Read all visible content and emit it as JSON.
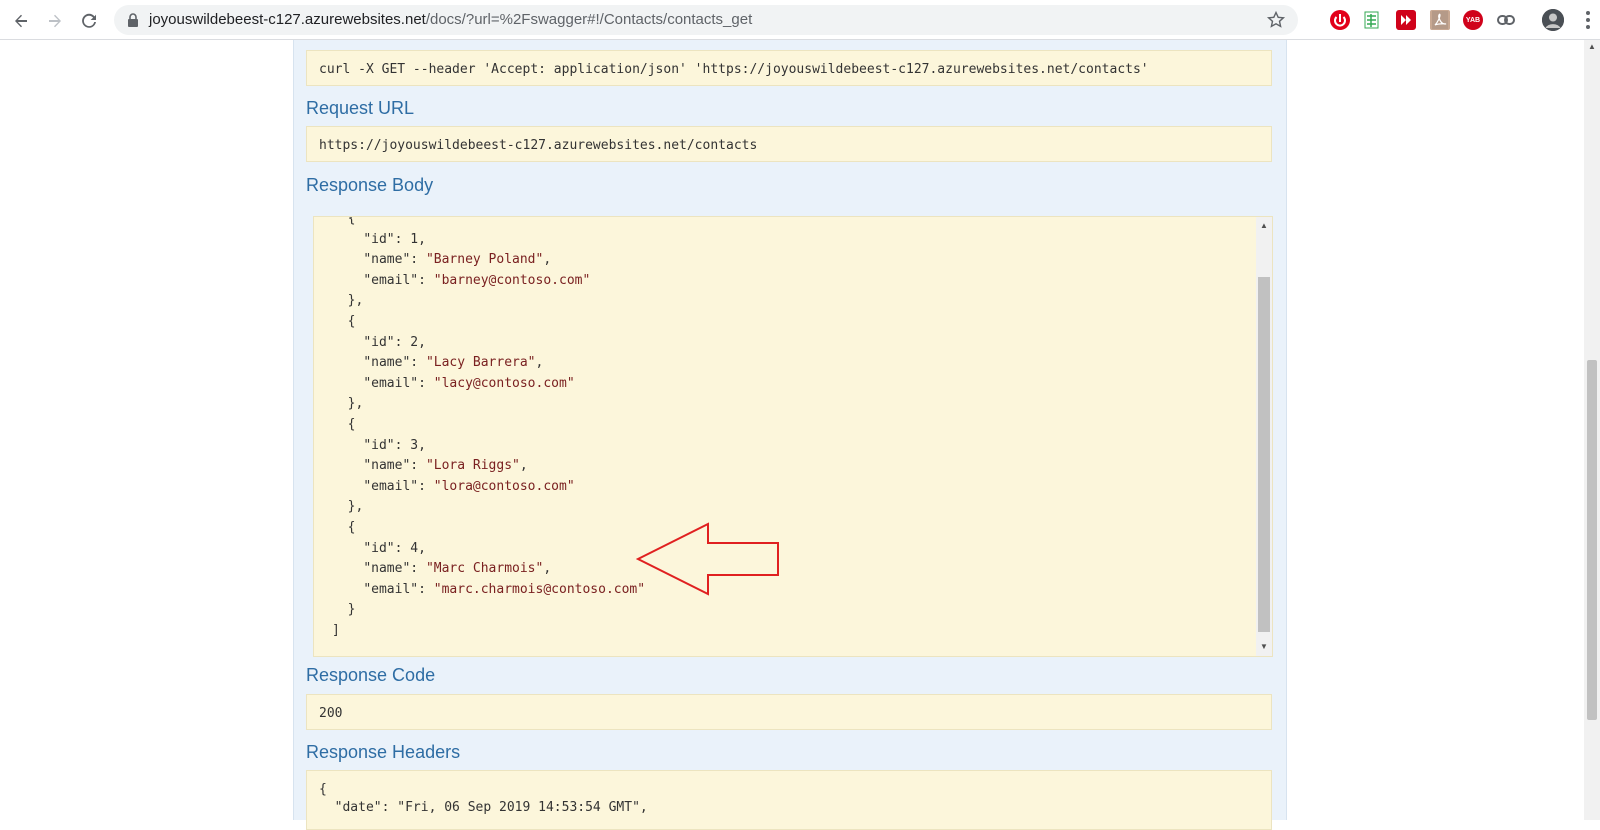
{
  "browser": {
    "url_host": "joyouswildebeest-c127.azurewebsites.net",
    "url_path": "/docs/?url=%2Fswagger#!/Contacts/contacts_get",
    "back_icon": "arrow-left-icon",
    "forward_icon": "arrow-right-icon",
    "reload_icon": "reload-icon",
    "lock_icon": "lock-icon",
    "star_icon": "star-icon",
    "extensions": [
      {
        "name": "opera-icon"
      },
      {
        "name": "sheets-icon"
      },
      {
        "name": "media-icon"
      },
      {
        "name": "pdf-icon"
      },
      {
        "name": "yab-icon",
        "label": "YAB"
      },
      {
        "name": "link-icon"
      }
    ]
  },
  "curl": {
    "command": "curl -X GET --header 'Accept: application/json' 'https://joyouswildebeest-c127.azurewebsites.net/contacts'"
  },
  "request_url": {
    "heading": "Request URL",
    "value": "https://joyouswildebeest-c127.azurewebsites.net/contacts"
  },
  "response_body": {
    "heading": "Response Body",
    "contacts": [
      {
        "id": "1",
        "name": "\"Barney Poland\"",
        "email": "\"barney@contoso.com\""
      },
      {
        "id": "2",
        "name": "\"Lacy Barrera\"",
        "email": "\"lacy@contoso.com\""
      },
      {
        "id": "3",
        "name": "\"Lora Riggs\"",
        "email": "\"lora@contoso.com\""
      },
      {
        "id": "4",
        "name": "\"Marc Charmois\"",
        "email": "\"marc.charmois@contoso.com\""
      }
    ],
    "keys": {
      "id": "\"id\"",
      "name": "\"name\"",
      "email": "\"email\""
    }
  },
  "response_code": {
    "heading": "Response Code",
    "value": "200"
  },
  "response_headers": {
    "heading": "Response Headers",
    "line1": "{",
    "line2": "  \"date\": \"Fri, 06 Sep 2019 14:53:54 GMT\","
  },
  "colors": {
    "panel_bg": "#eaf2fa",
    "code_bg": "#fcf6db",
    "heading": "#2e6da4",
    "string": "#7a2121",
    "annotation": "#e02020"
  }
}
